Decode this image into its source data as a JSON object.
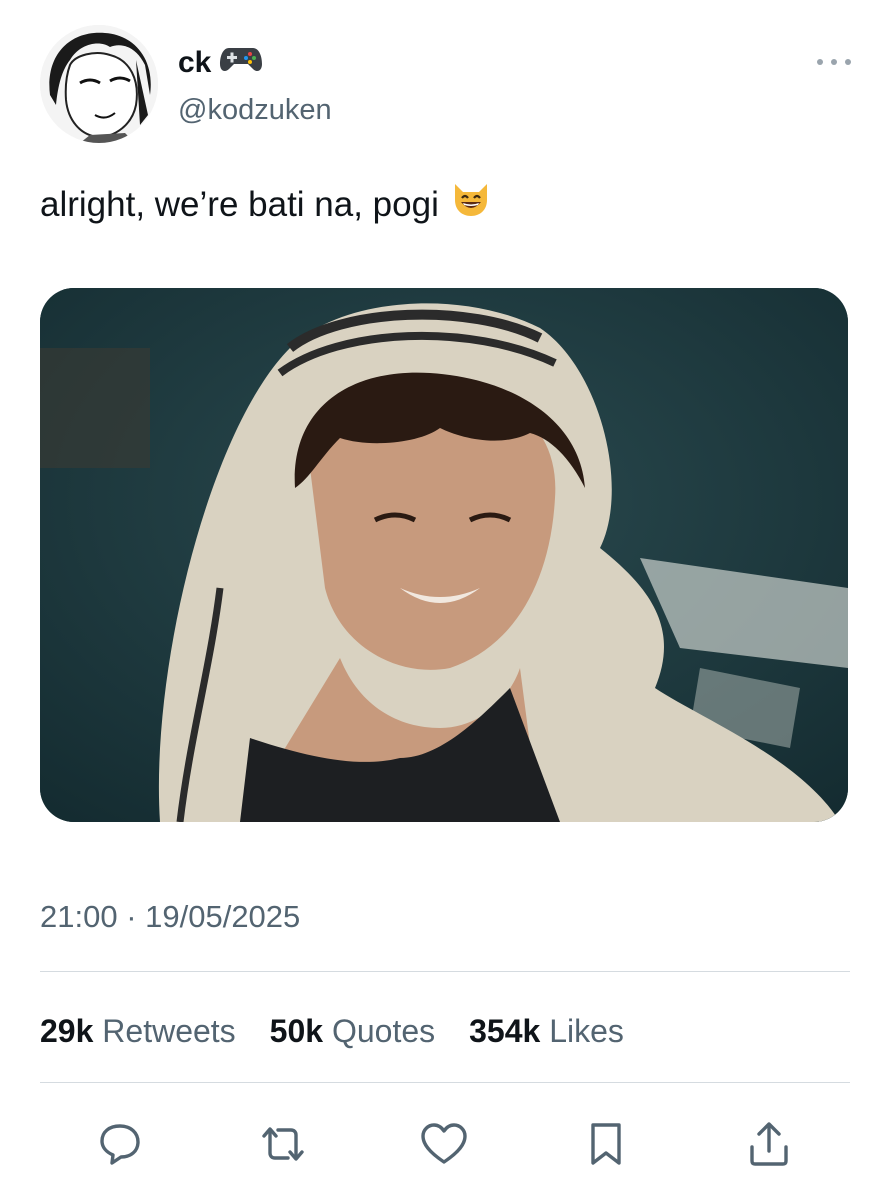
{
  "author": {
    "display_name": "ck",
    "handle": "@kodzuken",
    "name_badge_icon": "game-controller-icon",
    "avatar": "manga-style-avatar"
  },
  "tweet": {
    "text": "alright, we’re bati na, pogi",
    "emoji_icon": "grinning-cat-emoji-icon",
    "photo_alt": "photo",
    "timestamp": "21:00 · 19/05/2025"
  },
  "stats": [
    {
      "count": "29k",
      "label": "Retweets"
    },
    {
      "count": "50k",
      "label": "Quotes"
    },
    {
      "count": "354k",
      "label": "Likes"
    }
  ],
  "actions": [
    "reply-icon",
    "retweet-icon",
    "like-icon",
    "bookmark-icon",
    "share-icon"
  ],
  "colors": {
    "secondary_text": "#536471",
    "primary_text": "#0f1419",
    "divider": "#d5dbe0"
  }
}
